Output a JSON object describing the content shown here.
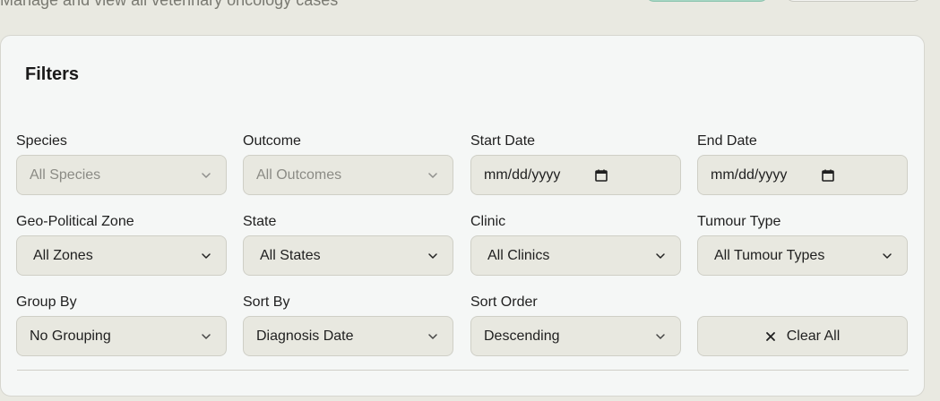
{
  "header": {
    "subtitle": "Manage and view all veterinary oncology cases"
  },
  "filters": {
    "title": "Filters",
    "species": {
      "label": "Species",
      "value": "All Species"
    },
    "outcome": {
      "label": "Outcome",
      "value": "All Outcomes"
    },
    "start_date": {
      "label": "Start Date",
      "value": "mm/dd/yyyy"
    },
    "end_date": {
      "label": "End Date",
      "value": "mm/dd/yyyy"
    },
    "zone": {
      "label": "Geo-Political Zone",
      "value": "All Zones"
    },
    "state": {
      "label": "State",
      "value": "All States"
    },
    "clinic": {
      "label": "Clinic",
      "value": "All Clinics"
    },
    "tumour_type": {
      "label": "Tumour Type",
      "value": "All Tumour Types"
    },
    "group_by": {
      "label": "Group By",
      "value": "No Grouping"
    },
    "sort_by": {
      "label": "Sort By",
      "value": "Diagnosis Date"
    },
    "sort_order": {
      "label": "Sort Order",
      "value": "Descending"
    },
    "clear_all": {
      "icon": "close-icon",
      "label": "Clear All"
    }
  },
  "colors": {
    "background": "#e9e9e1",
    "panel": "#f5f7f6",
    "control": "#e8e8e0",
    "primary_button": "#a7d6c4"
  }
}
